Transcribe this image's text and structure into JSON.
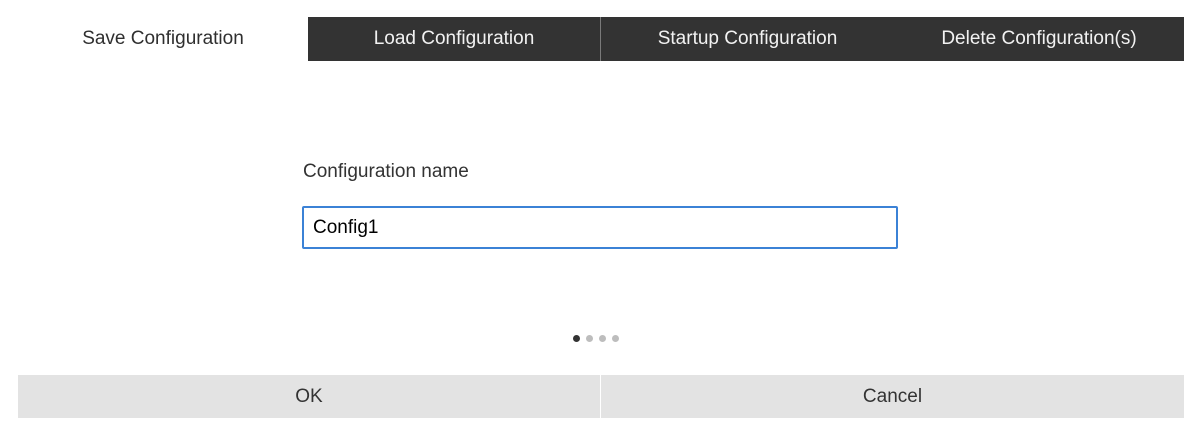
{
  "tabs": [
    {
      "label": "Save Configuration",
      "active": true
    },
    {
      "label": "Load Configuration",
      "active": false
    },
    {
      "label": "Startup Configuration",
      "active": false
    },
    {
      "label": "Delete Configuration(s)",
      "active": false
    }
  ],
  "form": {
    "label": "Configuration name",
    "value": "Config1"
  },
  "pager": {
    "total": 4,
    "current": 1
  },
  "buttons": {
    "ok": "OK",
    "cancel": "Cancel"
  },
  "colors": {
    "tab_inactive_bg": "#333333",
    "input_border": "#3b82d6",
    "button_bg": "#e3e3e3"
  }
}
